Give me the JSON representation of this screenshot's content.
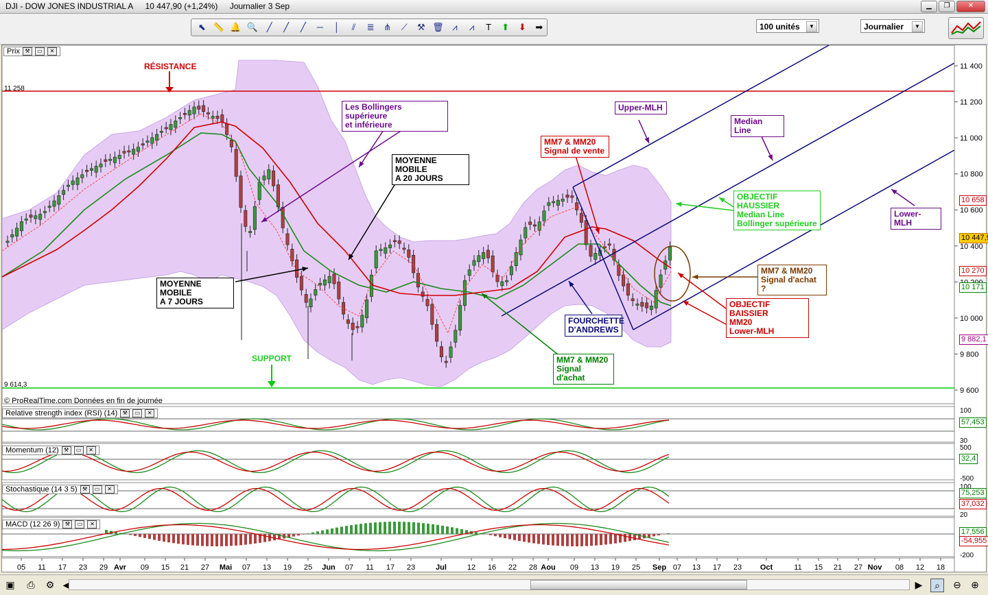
{
  "window": {
    "symbol": "DJI - DOW JONES INDUSTRIAL A",
    "last": "10 447,90 (+1,24%)",
    "period": "Journalier  3 Sep"
  },
  "toolbar": {
    "units_value": "100 unités",
    "period_value": "Journalier",
    "tool_icons": [
      "cursor-icon",
      "ruler-icon",
      "bell-icon",
      "zoom-icon",
      "line-icon",
      "line-icon",
      "line-icon",
      "horizontal-line-icon",
      "vertical-line-icon",
      "parallel-icon",
      "fibonacci-icon",
      "andrews-icon",
      "fan-icon",
      "tools-icon",
      "trash-icon",
      "channel-icon",
      "channel-icon",
      "text-icon",
      "arrow-up-icon",
      "arrow-down-icon",
      "arrow-right-icon"
    ]
  },
  "price_panel": {
    "label": "Prix",
    "resistance_value": "11 258",
    "support_value": "9 614,3",
    "copyright": "© ProRealTime.com Données en fin de journée",
    "y_ticks": [
      "11 400",
      "11 200",
      "11 000",
      "10 800",
      "10 600",
      "10 400",
      "10 200",
      "10 000",
      "9 800",
      "9 600"
    ],
    "price_tags": [
      {
        "value": "10 658",
        "color": "#c00000"
      },
      {
        "value": "10 447,9",
        "color": "#c07000",
        "bg": "#ffcc00"
      },
      {
        "value": "10 270",
        "color": "#c00000"
      },
      {
        "value": "10 171",
        "color": "#008000"
      },
      {
        "value": "9 882,1",
        "color": "#a00080"
      }
    ]
  },
  "annotations": {
    "resistance": "RÉSISTANCE",
    "support": "SUPPORT",
    "bollinger": "Les Bollingers supérieure\net inférieure",
    "mm20": "MOYENNE MOBILE\nA 20 JOURS",
    "mm7": "MOYENNE MOBILE\nA 7 JOURS",
    "sell_signal": "MM7 & MM20\nSignal de vente",
    "upper_mlh": "Upper-MLH",
    "median_line": "Median Line",
    "lower_mlh": "Lower-MLH",
    "bull_target": "OBJECTIF HAUSSIER\nMedian Line\nBollinger supérieure",
    "buy_signal_q": "MM7 & MM20\nSignal d'achat ?",
    "bear_target": "OBJECTIF BAISSIER\nMM20\nLower-MLH",
    "andrews": "FOURCHETTE\nD'ANDREWS",
    "buy_signal": "MM7 & MM20\nSignal d'achat"
  },
  "indicators": [
    {
      "label": "Relative strength index (RSI) (14)",
      "ticks": [
        "100",
        "30"
      ],
      "values": [
        {
          "value": "57,453",
          "color": "#008000"
        }
      ]
    },
    {
      "label": "Momentum (12)",
      "ticks": [
        "500",
        "-500"
      ],
      "values": [
        {
          "value": "32,4",
          "color": "#008000"
        }
      ]
    },
    {
      "label": "Stochastique (14 3 5)",
      "ticks": [
        "100",
        "20"
      ],
      "values": [
        {
          "value": "75,253",
          "color": "#008000"
        },
        {
          "value": "37,032",
          "color": "#c00000"
        }
      ]
    },
    {
      "label": "MACD (12 26 9)",
      "ticks": [
        "-200"
      ],
      "values": [
        {
          "value": "17,556",
          "color": "#008000"
        },
        {
          "value": "-54,955",
          "color": "#c00000"
        }
      ]
    }
  ],
  "x_axis": [
    "05",
    "11",
    "17",
    "23",
    "29",
    "Avr",
    "09",
    "15",
    "21",
    "27",
    "Mai",
    "07",
    "13",
    "19",
    "25",
    "Jun",
    "07",
    "11",
    "17",
    "23",
    "Jul",
    "12",
    "16",
    "22",
    "28",
    "Aou",
    "09",
    "13",
    "19",
    "25",
    "Sep",
    "07",
    "13",
    "17",
    "23",
    "Oct",
    "11",
    "15",
    "21",
    "27",
    "Nov",
    "08",
    "12",
    "18"
  ],
  "colors": {
    "resistance": "#d00000",
    "support": "#00cc00",
    "bollinger_fill": "#e6ccf5",
    "mm20": "#d00000",
    "mm7": "#ff4444",
    "andrews": "#0a0a7a",
    "bull": "#22cc22",
    "bear": "#cc0000",
    "purple": "#6a0a8a"
  }
}
